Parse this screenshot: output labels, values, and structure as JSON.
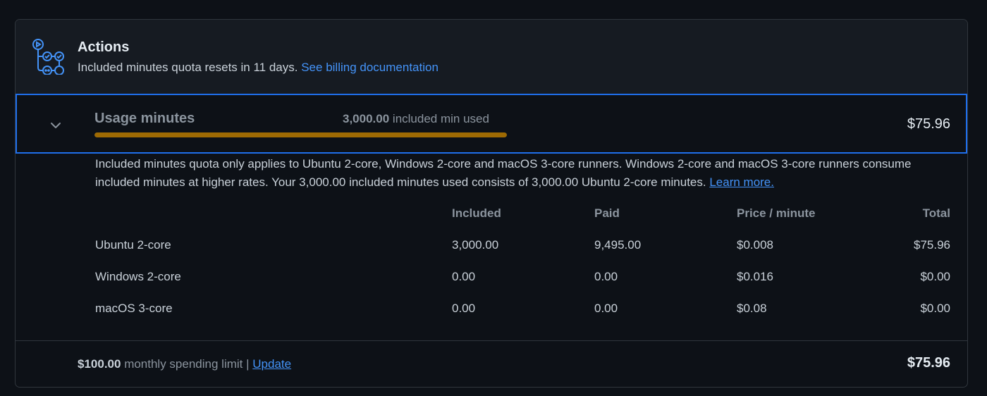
{
  "header": {
    "title": "Actions",
    "subtitle": "Included minutes quota resets in 11 days.",
    "billing_link": "See billing documentation"
  },
  "usage": {
    "label": "Usage minutes",
    "used_amount": "3,000.00",
    "used_suffix": "included min used",
    "progress_fraction": 1.0,
    "cost": "$75.96"
  },
  "description": {
    "text": "Included minutes quota only applies to Ubuntu 2-core, Windows 2-core and macOS 3-core runners. Windows 2-core and macOS 3-core runners consume included minutes at higher rates. Your 3,000.00 included minutes used consists of 3,000.00 Ubuntu 2-core minutes.",
    "learn_more": "Learn more."
  },
  "table": {
    "headers": [
      "Included",
      "Paid",
      "Price / minute",
      "Total"
    ],
    "rows": [
      {
        "name": "Ubuntu 2-core",
        "included": "3,000.00",
        "paid": "9,495.00",
        "price": "$0.008",
        "total": "$75.96"
      },
      {
        "name": "Windows 2-core",
        "included": "0.00",
        "paid": "0.00",
        "price": "$0.016",
        "total": "$0.00"
      },
      {
        "name": "macOS 3-core",
        "included": "0.00",
        "paid": "0.00",
        "price": "$0.08",
        "total": "$0.00"
      }
    ]
  },
  "footer": {
    "limit_amount": "$100.00",
    "limit_text": "monthly spending limit |",
    "update_link": "Update",
    "total": "$75.96"
  },
  "colors": {
    "accent": "#4493f8",
    "focus_border": "#1f6feb",
    "progress": "#9e6a03"
  },
  "icons": [
    "actions-workflow-icon",
    "chevron-down-icon"
  ]
}
